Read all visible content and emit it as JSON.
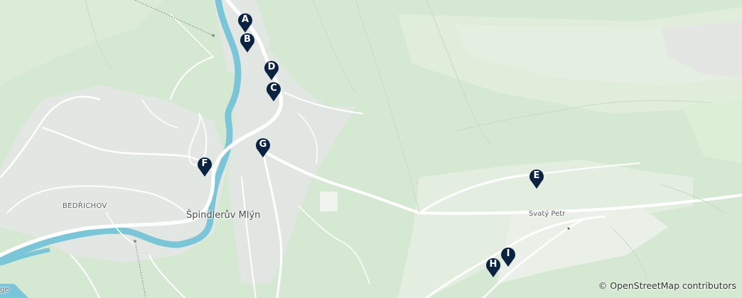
{
  "map": {
    "place_labels": {
      "town": "Špindlerův Mlýn",
      "bedrichov": "BEDŘICHOV",
      "svaty_petr": "Svatý Petr",
      "edge": "ge"
    },
    "markers": [
      {
        "id": "A",
        "label": "A"
      },
      {
        "id": "B",
        "label": "B"
      },
      {
        "id": "C",
        "label": "C"
      },
      {
        "id": "D",
        "label": "D"
      },
      {
        "id": "E",
        "label": "E"
      },
      {
        "id": "F",
        "label": "F"
      },
      {
        "id": "G",
        "label": "G"
      },
      {
        "id": "H",
        "label": "H"
      },
      {
        "id": "I",
        "label": "I"
      }
    ],
    "attribution": "© OpenStreetMap contributors",
    "colors": {
      "forest": "#d5e9d2",
      "grass": "#e4efdf",
      "urban": "#e2e6e3",
      "water": "#7ac6d8",
      "road": "#ffffff",
      "marker": "#0b2240"
    }
  }
}
